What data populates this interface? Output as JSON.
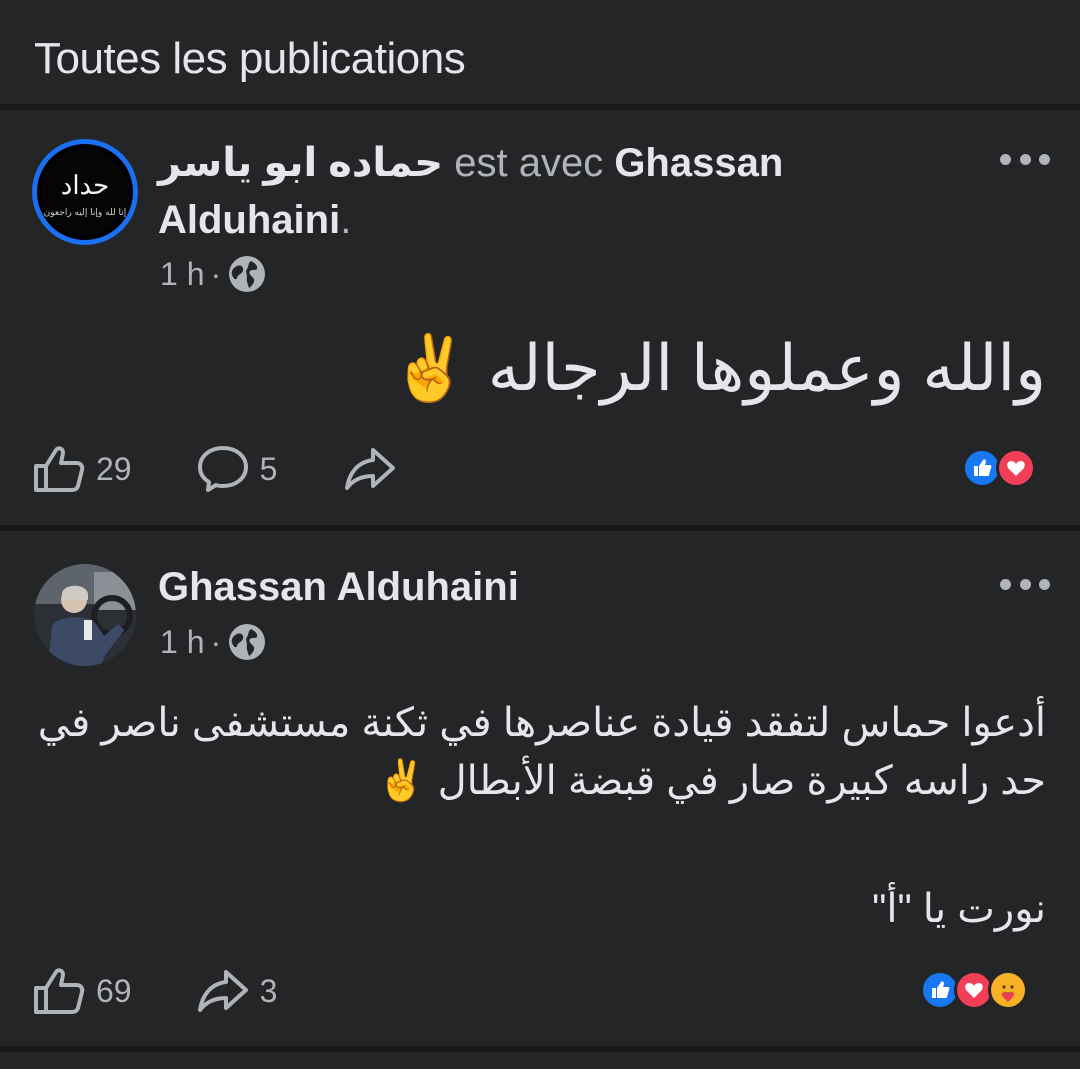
{
  "section_title": "Toutes les publications",
  "posts": [
    {
      "author": "حماده ابو ياسر",
      "connector": " est avec ",
      "tagged": "Ghassan",
      "tagged_line2": "Alduhaini",
      "tagged_suffix": ".",
      "avatar_text": "حداد",
      "avatar_subtext": "إنا لله وإنا إليه راجعون",
      "time": "1 h",
      "dot": "·",
      "text_lines": [
        "والله وعملوها الرجاله ✌️"
      ],
      "likes": "29",
      "comments": "5",
      "reactions": [
        "like-reaction-icon",
        "love-reaction-icon"
      ]
    },
    {
      "author": "Ghassan Alduhaini",
      "time": "1 h",
      "dot": "·",
      "text_lines": [
        "أدعوا حماس لتفقد قيادة عناصرها في  ثكنة مستشفى ناصر في",
        "حد راسه كبيرة صار في قبضة الأبطال ✌️",
        "نورت يا \"أ\""
      ],
      "likes": "69",
      "shares": "3",
      "reactions": [
        "like-reaction-icon",
        "love-reaction-icon",
        "care-reaction-icon"
      ]
    }
  ],
  "colors": {
    "background": "#242526",
    "divider": "#18191a",
    "text": "#e4e6eb",
    "muted": "#b0b3b8",
    "like_blue": "#1877f2",
    "love_red": "#f33e58",
    "care_yellow": "#f7b125"
  }
}
